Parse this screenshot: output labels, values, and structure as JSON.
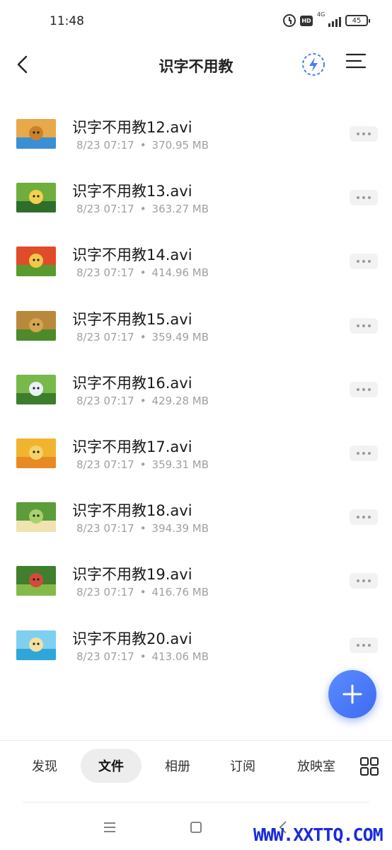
{
  "status_bar": {
    "time": "11:48",
    "hd_label": "HD",
    "network_label": "4G",
    "battery": "45"
  },
  "header": {
    "title": "识字不用教",
    "back_icon": "chevron-left-icon",
    "flash_icon": "lightning-circle-icon",
    "menu_icon": "sort-lines-icon"
  },
  "files": [
    {
      "name": "识字不用教12.avi",
      "date": "8/23 07:17",
      "size": "370.95 MB",
      "thumb": [
        "#e8a94a",
        "#c9822a",
        "#3a8fd6"
      ]
    },
    {
      "name": "识字不用教13.avi",
      "date": "8/23 07:17",
      "size": "363.27 MB",
      "thumb": [
        "#6fae3c",
        "#f3d24a",
        "#2e6e2a"
      ]
    },
    {
      "name": "识字不用教14.avi",
      "date": "8/23 07:17",
      "size": "414.96 MB",
      "thumb": [
        "#e04b2a",
        "#f2c84b",
        "#5a9b2e"
      ]
    },
    {
      "name": "识字不用教15.avi",
      "date": "8/23 07:17",
      "size": "359.49 MB",
      "thumb": [
        "#b8893c",
        "#d4a650",
        "#4f8a2a"
      ]
    },
    {
      "name": "识字不用教16.avi",
      "date": "8/23 07:17",
      "size": "429.28 MB",
      "thumb": [
        "#79b84a",
        "#e9f1f7",
        "#3d7d2c"
      ]
    },
    {
      "name": "识字不用教17.avi",
      "date": "8/23 07:17",
      "size": "359.31 MB",
      "thumb": [
        "#f1b42f",
        "#f5d36b",
        "#e88a24"
      ]
    },
    {
      "name": "识字不用教18.avi",
      "date": "8/23 07:17",
      "size": "394.39 MB",
      "thumb": [
        "#5d9c3b",
        "#a7d26c",
        "#f0e3b0"
      ]
    },
    {
      "name": "识字不用教19.avi",
      "date": "8/23 07:17",
      "size": "416.76 MB",
      "thumb": [
        "#3f7f2d",
        "#d24a3a",
        "#87b94a"
      ]
    },
    {
      "name": "识字不用教20.avi",
      "date": "8/23 07:17",
      "size": "413.06 MB",
      "thumb": [
        "#7fd0f0",
        "#f3e1a4",
        "#2fa6d8"
      ]
    }
  ],
  "fab_icon": "plus-icon",
  "tabs": [
    {
      "label": "发现",
      "active": false
    },
    {
      "label": "文件",
      "active": true
    },
    {
      "label": "相册",
      "active": false
    },
    {
      "label": "订阅",
      "active": false
    },
    {
      "label": "放映室",
      "active": false
    }
  ],
  "grid_icon": "grid-icon",
  "accent_color": "#4a7bf7",
  "watermark": "WWW.XXTTQ.COM"
}
